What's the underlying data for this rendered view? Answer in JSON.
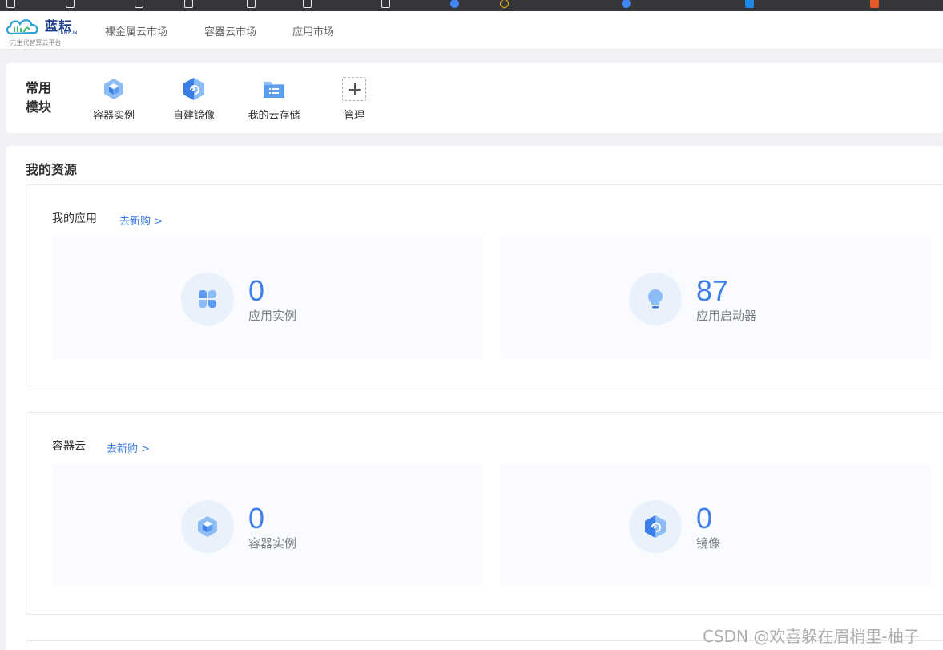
{
  "brand": {
    "name": "蓝耘",
    "sub": "LANYUN",
    "slogan": "·元生代智算云平台·"
  },
  "topnav": {
    "items": [
      "裸金属云市场",
      "容器云市场",
      "应用市场"
    ]
  },
  "quick": {
    "title": "常用模块",
    "items": [
      {
        "label": "容器实例",
        "icon": "cube-icon"
      },
      {
        "label": "自建镜像",
        "icon": "image-hexagon-icon"
      },
      {
        "label": "我的云存储",
        "icon": "folder-list-icon"
      },
      {
        "label": "管理",
        "icon": "plus-icon"
      }
    ]
  },
  "resources": {
    "title": "我的资源",
    "groups": [
      {
        "title": "我的应用",
        "link": "去新购 >",
        "stats": [
          {
            "value": "0",
            "label": "应用实例",
            "icon": "grid-clover-icon"
          },
          {
            "value": "87",
            "label": "应用启动器",
            "icon": "lightbulb-icon"
          }
        ]
      },
      {
        "title": "容器云",
        "link": "去新购 >",
        "stats": [
          {
            "value": "0",
            "label": "容器实例",
            "icon": "cube-icon"
          },
          {
            "value": "0",
            "label": "镜像",
            "icon": "image-hexagon-icon"
          }
        ]
      }
    ]
  },
  "watermark": "CSDN @欢喜躲在眉梢里-柚子",
  "colors": {
    "accent": "#4080e8",
    "icon_light": "#8cbdf6",
    "icon_dark": "#3a7ee6",
    "circle_bg": "#e9f1fd",
    "panel_bg": "#f9fbfe"
  }
}
